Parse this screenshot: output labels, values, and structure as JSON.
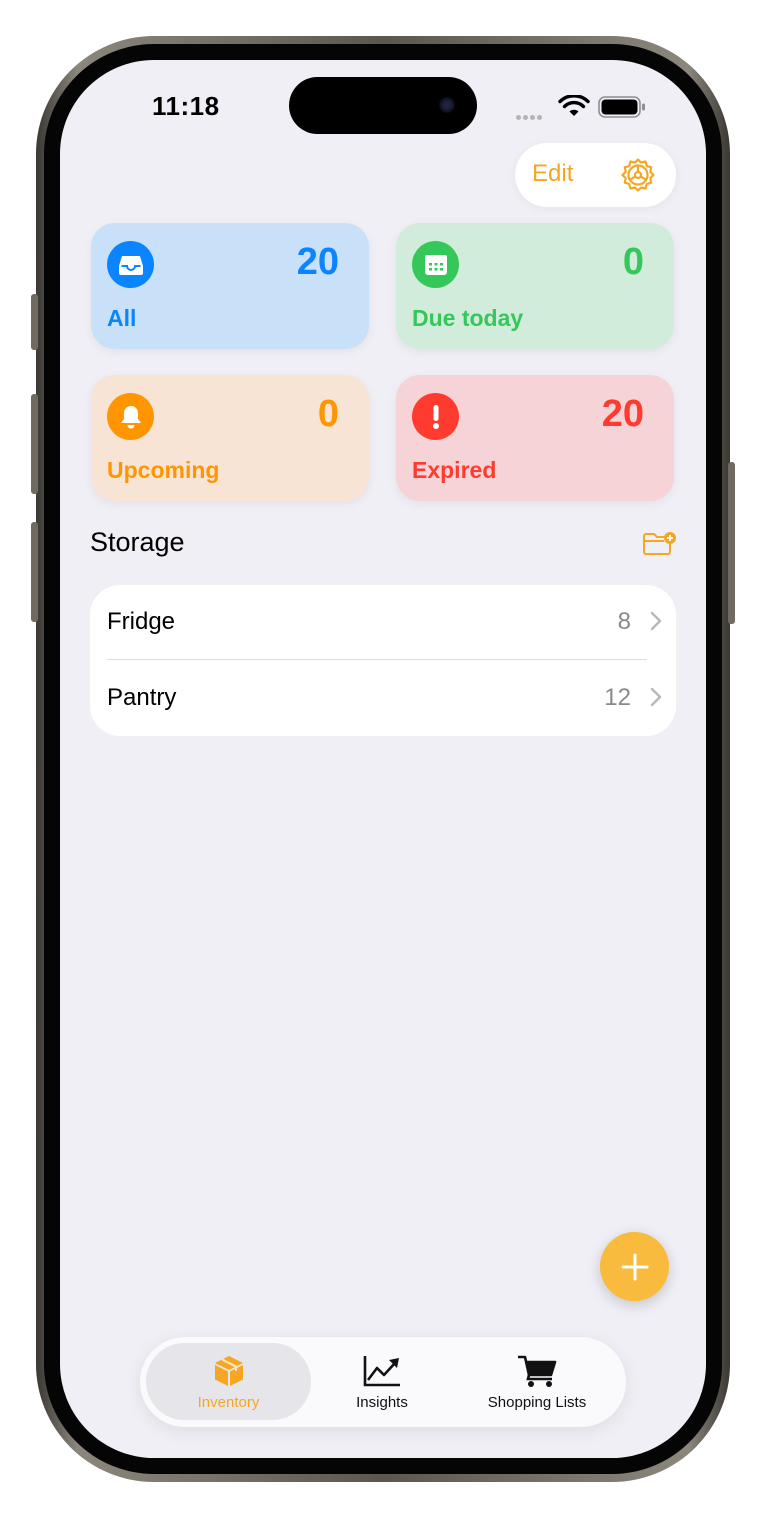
{
  "status_bar": {
    "time": "11:18"
  },
  "header": {
    "edit_label": "Edit"
  },
  "summary_cards": [
    {
      "label": "All",
      "count": "20",
      "color": "#0a84ff",
      "bg": "#c8e1f8",
      "icon": "tray-icon"
    },
    {
      "label": "Due today",
      "count": "0",
      "color": "#34c759",
      "bg": "#d2ecdb",
      "icon": "calendar-icon"
    },
    {
      "label": "Upcoming",
      "count": "0",
      "color": "#ff9500",
      "bg": "#f8e4d5",
      "icon": "bell-icon"
    },
    {
      "label": "Expired",
      "count": "20",
      "color": "#ff3b30",
      "bg": "#f6d3d6",
      "icon": "exclamation-icon"
    }
  ],
  "storage": {
    "title": "Storage",
    "items": [
      {
        "name": "Fridge",
        "count": "8"
      },
      {
        "name": "Pantry",
        "count": "12"
      }
    ]
  },
  "tabs": [
    {
      "label": "Inventory",
      "icon": "box-icon",
      "active": true
    },
    {
      "label": "Insights",
      "icon": "chart-icon",
      "active": false
    },
    {
      "label": "Shopping Lists",
      "icon": "cart-icon",
      "active": false
    }
  ],
  "colors": {
    "accent": "#f5a623",
    "background": "#f0eff5"
  }
}
